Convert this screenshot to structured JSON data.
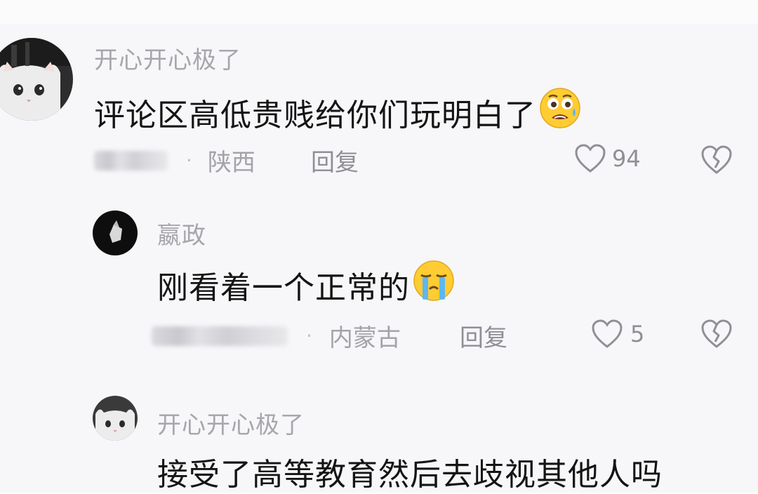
{
  "comments": [
    {
      "username": "开心开心极了",
      "text": "评论区高低贵贱给你们玩明白了",
      "emoji": "shocked-crying-emoji",
      "location": "陕西",
      "reply_label": "回复",
      "likes": "94"
    },
    {
      "username": "嬴政",
      "text": "刚看着一个正常的",
      "emoji": "crying-emoji",
      "location": "内蒙古",
      "reply_label": "回复",
      "likes": "5"
    },
    {
      "username": "开心开心极了",
      "text": "接受了高等教育然后去歧视其他人吗"
    }
  ],
  "meta_separator": "·",
  "colors": {
    "username": "#a6a6ad",
    "content": "#141414",
    "meta": "#a3a3aa",
    "background": "#f7f7f9"
  }
}
